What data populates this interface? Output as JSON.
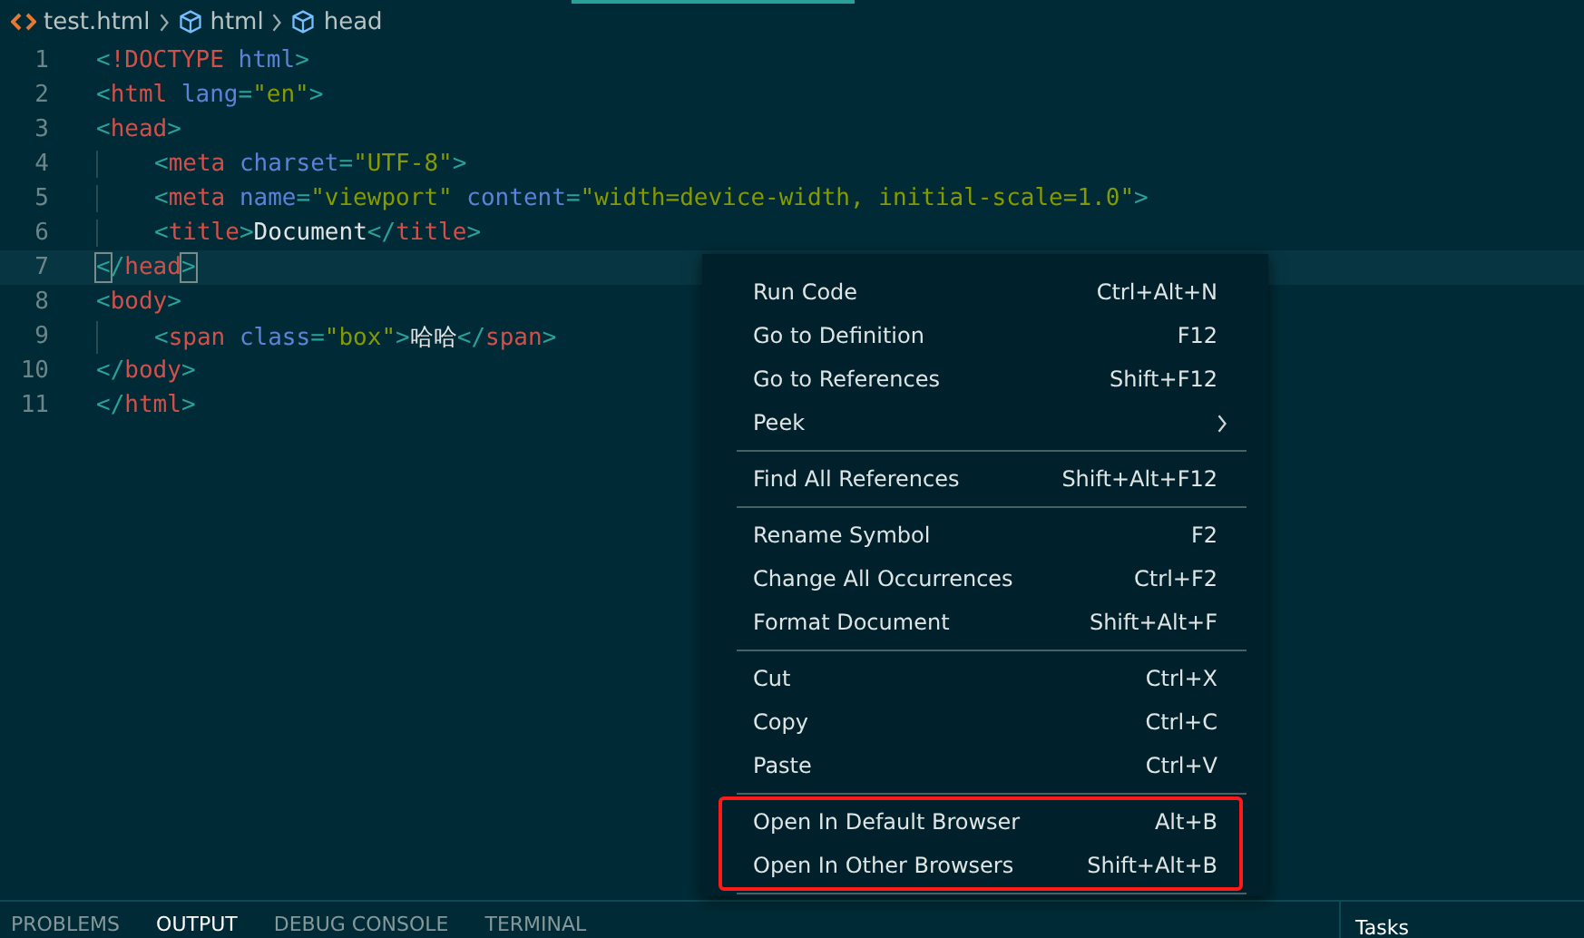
{
  "breadcrumb": [
    {
      "kind": "file",
      "label": "test.html"
    },
    {
      "kind": "symbol",
      "label": "html"
    },
    {
      "kind": "symbol",
      "label": "head"
    }
  ],
  "editor": {
    "lines": [
      {
        "number": "1",
        "current": false,
        "indented": false,
        "tokens": [
          {
            "kind": "punct",
            "text": "<"
          },
          {
            "kind": "tag",
            "text": "!DOCTYPE"
          },
          {
            "kind": "attr",
            "text": "html",
            "space_before": true
          },
          {
            "kind": "punct",
            "text": ">"
          }
        ]
      },
      {
        "number": "2",
        "current": false,
        "indented": false,
        "tokens": [
          {
            "kind": "punct",
            "text": "<"
          },
          {
            "kind": "tag",
            "text": "html"
          },
          {
            "kind": "attr",
            "text": "lang",
            "space_before": true
          },
          {
            "kind": "punct",
            "text": "="
          },
          {
            "kind": "string",
            "text": "\"en\""
          },
          {
            "kind": "punct",
            "text": ">"
          }
        ]
      },
      {
        "number": "3",
        "current": false,
        "indented": false,
        "tokens": [
          {
            "kind": "punct",
            "text": "<"
          },
          {
            "kind": "tag",
            "text": "head"
          },
          {
            "kind": "punct",
            "text": ">"
          }
        ]
      },
      {
        "number": "4",
        "current": false,
        "indented": true,
        "tokens": [
          {
            "kind": "punct",
            "text": "<"
          },
          {
            "kind": "tag",
            "text": "meta"
          },
          {
            "kind": "attr",
            "text": "charset",
            "space_before": true
          },
          {
            "kind": "punct",
            "text": "="
          },
          {
            "kind": "string",
            "text": "\"UTF-8\""
          },
          {
            "kind": "punct",
            "text": ">"
          }
        ]
      },
      {
        "number": "5",
        "current": false,
        "indented": true,
        "tokens": [
          {
            "kind": "punct",
            "text": "<"
          },
          {
            "kind": "tag",
            "text": "meta"
          },
          {
            "kind": "attr",
            "text": "name",
            "space_before": true
          },
          {
            "kind": "punct",
            "text": "="
          },
          {
            "kind": "string",
            "text": "\"viewport\""
          },
          {
            "kind": "attr",
            "text": "content",
            "space_before": true
          },
          {
            "kind": "punct",
            "text": "="
          },
          {
            "kind": "string",
            "text": "\"width=device-width, initial-scale=1.0\""
          },
          {
            "kind": "punct",
            "text": ">"
          }
        ]
      },
      {
        "number": "6",
        "current": false,
        "indented": true,
        "tokens": [
          {
            "kind": "punct",
            "text": "<"
          },
          {
            "kind": "tag",
            "text": "title"
          },
          {
            "kind": "punct",
            "text": ">"
          },
          {
            "kind": "text",
            "text": "Document"
          },
          {
            "kind": "punct",
            "text": "</"
          },
          {
            "kind": "tag",
            "text": "title"
          },
          {
            "kind": "punct",
            "text": ">"
          }
        ]
      },
      {
        "number": "7",
        "current": true,
        "indented": false,
        "tokens": [
          {
            "kind": "punct",
            "text": "<",
            "matched": true
          },
          {
            "kind": "punct",
            "text": "/"
          },
          {
            "kind": "tag",
            "text": "head"
          },
          {
            "kind": "punct",
            "text": ">",
            "matched": true
          }
        ]
      },
      {
        "number": "8",
        "current": false,
        "indented": false,
        "tokens": [
          {
            "kind": "punct",
            "text": "<"
          },
          {
            "kind": "tag",
            "text": "body"
          },
          {
            "kind": "punct",
            "text": ">"
          }
        ]
      },
      {
        "number": "9",
        "current": false,
        "indented": true,
        "tokens": [
          {
            "kind": "punct",
            "text": "<"
          },
          {
            "kind": "tag",
            "text": "span"
          },
          {
            "kind": "attr",
            "text": "class",
            "space_before": true
          },
          {
            "kind": "punct",
            "text": "="
          },
          {
            "kind": "string",
            "text": "\"box\""
          },
          {
            "kind": "punct",
            "text": ">"
          },
          {
            "kind": "text",
            "text": "哈哈"
          },
          {
            "kind": "punct",
            "text": "</"
          },
          {
            "kind": "tag",
            "text": "span"
          },
          {
            "kind": "punct",
            "text": ">"
          }
        ]
      },
      {
        "number": "10",
        "current": false,
        "indented": false,
        "tokens": [
          {
            "kind": "punct",
            "text": "</"
          },
          {
            "kind": "tag",
            "text": "body"
          },
          {
            "kind": "punct",
            "text": ">"
          }
        ]
      },
      {
        "number": "11",
        "current": false,
        "indented": false,
        "tokens": [
          {
            "kind": "punct",
            "text": "</"
          },
          {
            "kind": "tag",
            "text": "html"
          },
          {
            "kind": "punct",
            "text": ">"
          }
        ]
      }
    ]
  },
  "context_menu": {
    "groups": [
      {
        "highlighted": false,
        "items": [
          {
            "kind": "command",
            "label": "Run Code",
            "shortcut": "Ctrl+Alt+N"
          },
          {
            "kind": "command",
            "label": "Go to Definition",
            "shortcut": "F12"
          },
          {
            "kind": "command",
            "label": "Go to References",
            "shortcut": "Shift+F12"
          },
          {
            "kind": "submenu",
            "label": "Peek"
          }
        ]
      },
      {
        "highlighted": false,
        "items": [
          {
            "kind": "command",
            "label": "Find All References",
            "shortcut": "Shift+Alt+F12"
          }
        ]
      },
      {
        "highlighted": false,
        "items": [
          {
            "kind": "command",
            "label": "Rename Symbol",
            "shortcut": "F2"
          },
          {
            "kind": "command",
            "label": "Change All Occurrences",
            "shortcut": "Ctrl+F2"
          },
          {
            "kind": "command",
            "label": "Format Document",
            "shortcut": "Shift+Alt+F"
          }
        ]
      },
      {
        "highlighted": false,
        "items": [
          {
            "kind": "command",
            "label": "Cut",
            "shortcut": "Ctrl+X"
          },
          {
            "kind": "command",
            "label": "Copy",
            "shortcut": "Ctrl+C"
          },
          {
            "kind": "command",
            "label": "Paste",
            "shortcut": "Ctrl+V"
          }
        ]
      },
      {
        "highlighted": true,
        "items": [
          {
            "kind": "command",
            "label": "Open In Default Browser",
            "shortcut": "Alt+B"
          },
          {
            "kind": "command",
            "label": "Open In Other Browsers",
            "shortcut": "Shift+Alt+B"
          }
        ]
      }
    ]
  },
  "panel": {
    "tabs": [
      {
        "label": "PROBLEMS",
        "selected": false
      },
      {
        "label": "OUTPUT",
        "selected": true
      },
      {
        "label": "DEBUG CONSOLE",
        "selected": false
      },
      {
        "label": "TERMINAL",
        "selected": false
      }
    ],
    "side_label": "Tasks"
  }
}
